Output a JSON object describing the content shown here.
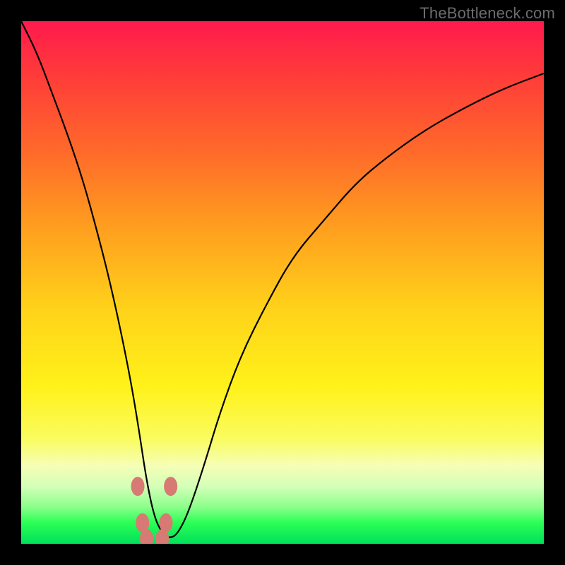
{
  "watermark": "TheBottleneck.com",
  "chart_data": {
    "type": "line",
    "title": "",
    "xlabel": "",
    "ylabel": "",
    "xlim": [
      0,
      100
    ],
    "ylim": [
      0,
      100
    ],
    "grid": false,
    "legend": false,
    "x": [
      0,
      3,
      6,
      9,
      12,
      15,
      17,
      19,
      21,
      22.5,
      24,
      25.5,
      27,
      28.5,
      30,
      32,
      35,
      38,
      42,
      47,
      52,
      58,
      64,
      70,
      77,
      84,
      92,
      100
    ],
    "values": [
      100,
      94,
      86,
      78,
      69,
      58,
      50,
      41,
      31,
      22,
      12,
      5,
      2,
      1,
      2,
      6,
      15,
      25,
      36,
      46,
      55,
      62,
      69,
      74,
      79,
      83,
      87,
      90
    ],
    "markers": {
      "x": [
        22.3,
        23.2,
        27.7,
        28.6,
        24.0,
        27.0
      ],
      "y": [
        11,
        4,
        4,
        11,
        1,
        1
      ]
    },
    "background_gradient": [
      "#ff1a4d",
      "#ffd21a",
      "#00e05a"
    ]
  }
}
